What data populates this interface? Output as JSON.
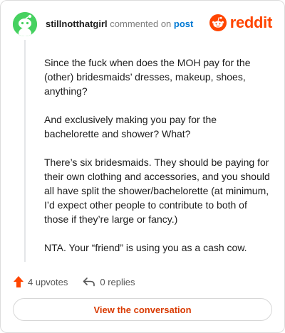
{
  "comment": {
    "username": "stillnotthatgirl",
    "action_text": "commented on",
    "post_link": "post",
    "paragraphs": [
      "Since the fuck when does the MOH pay for the (other) bridesmaids’ dresses, makeup, shoes, anything?",
      "And exclusively making you pay for the bachelorette and shower? What?",
      "There’s six bridesmaids. They should be paying for their own clothing and accessories, and you should all have split the shower/bachelorette (at minimum, I’d expect other people to contribute to both of those if they’re large or fancy.)",
      "NTA. Your “friend” is using you as a cash cow."
    ]
  },
  "brand": {
    "name": "reddit",
    "icon": "reddit-logo-icon",
    "color": "#ff4500"
  },
  "footer": {
    "upvotes_label": "4 upvotes",
    "upvote_icon": "upvote-arrow-icon",
    "replies_label": "0 replies",
    "reply_icon": "reply-icon"
  },
  "cta": {
    "label": "View the conversation"
  },
  "colors": {
    "accent": "#ff4500",
    "link": "#0079d3",
    "avatar_bg": "#46d160",
    "cta_text": "#d93a00"
  }
}
